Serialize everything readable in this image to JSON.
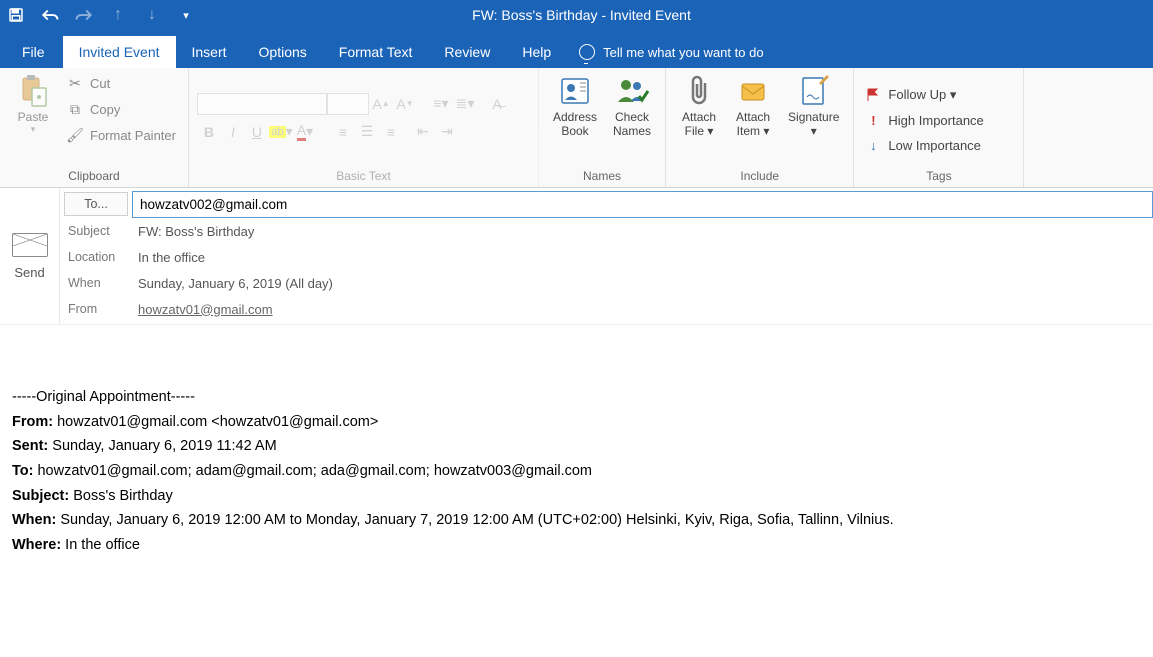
{
  "title": "FW: Boss's Birthday  -  Invited Event",
  "qat": {
    "save": "save-icon",
    "undo": "undo-icon",
    "redo": "redo-icon",
    "up": "up-icon",
    "down": "down-icon"
  },
  "tabs": {
    "file": "File",
    "items": [
      "Invited Event",
      "Insert",
      "Options",
      "Format Text",
      "Review",
      "Help"
    ],
    "active_index": 0,
    "tell_me": "Tell me what you want to do"
  },
  "ribbon": {
    "clipboard": {
      "paste": "Paste",
      "cut": "Cut",
      "copy": "Copy",
      "format_painter": "Format Painter",
      "group": "Clipboard"
    },
    "basic_text": {
      "group": "Basic Text"
    },
    "names": {
      "address_book": "Address\nBook",
      "check_names": "Check\nNames",
      "group": "Names"
    },
    "include": {
      "attach_file": "Attach\nFile ▾",
      "attach_item": "Attach\nItem ▾",
      "signature": "Signature\n▾",
      "group": "Include"
    },
    "tags": {
      "follow_up": "Follow Up ▾",
      "high": "High Importance",
      "low": "Low Importance",
      "group": "Tags"
    }
  },
  "compose": {
    "send": "Send",
    "to_label": "To...",
    "to_value": "howzatv002@gmail.com",
    "subject_label": "Subject",
    "subject_value": "FW: Boss's Birthday",
    "location_label": "Location",
    "location_value": "In the office",
    "when_label": "When",
    "when_value": "Sunday, January 6, 2019 (All day)",
    "from_label": "From",
    "from_value": "howzatv01@gmail.com"
  },
  "body": {
    "divider": "-----Original Appointment-----",
    "from_lbl": "From:",
    "from_val": " howzatv01@gmail.com <howzatv01@gmail.com>",
    "sent_lbl": "Sent:",
    "sent_val": " Sunday, January 6, 2019 11:42 AM",
    "to_lbl": "To:",
    "to_val": " howzatv01@gmail.com; adam@gmail.com; ada@gmail.com; howzatv003@gmail.com",
    "subject_lbl": "Subject:",
    "subject_val": " Boss's Birthday",
    "when_lbl": "When:",
    "when_val": " Sunday, January 6, 2019 12:00 AM to Monday, January 7, 2019 12:00 AM (UTC+02:00) Helsinki, Kyiv, Riga, Sofia, Tallinn, Vilnius.",
    "where_lbl": "Where:",
    "where_val": " In the office"
  }
}
